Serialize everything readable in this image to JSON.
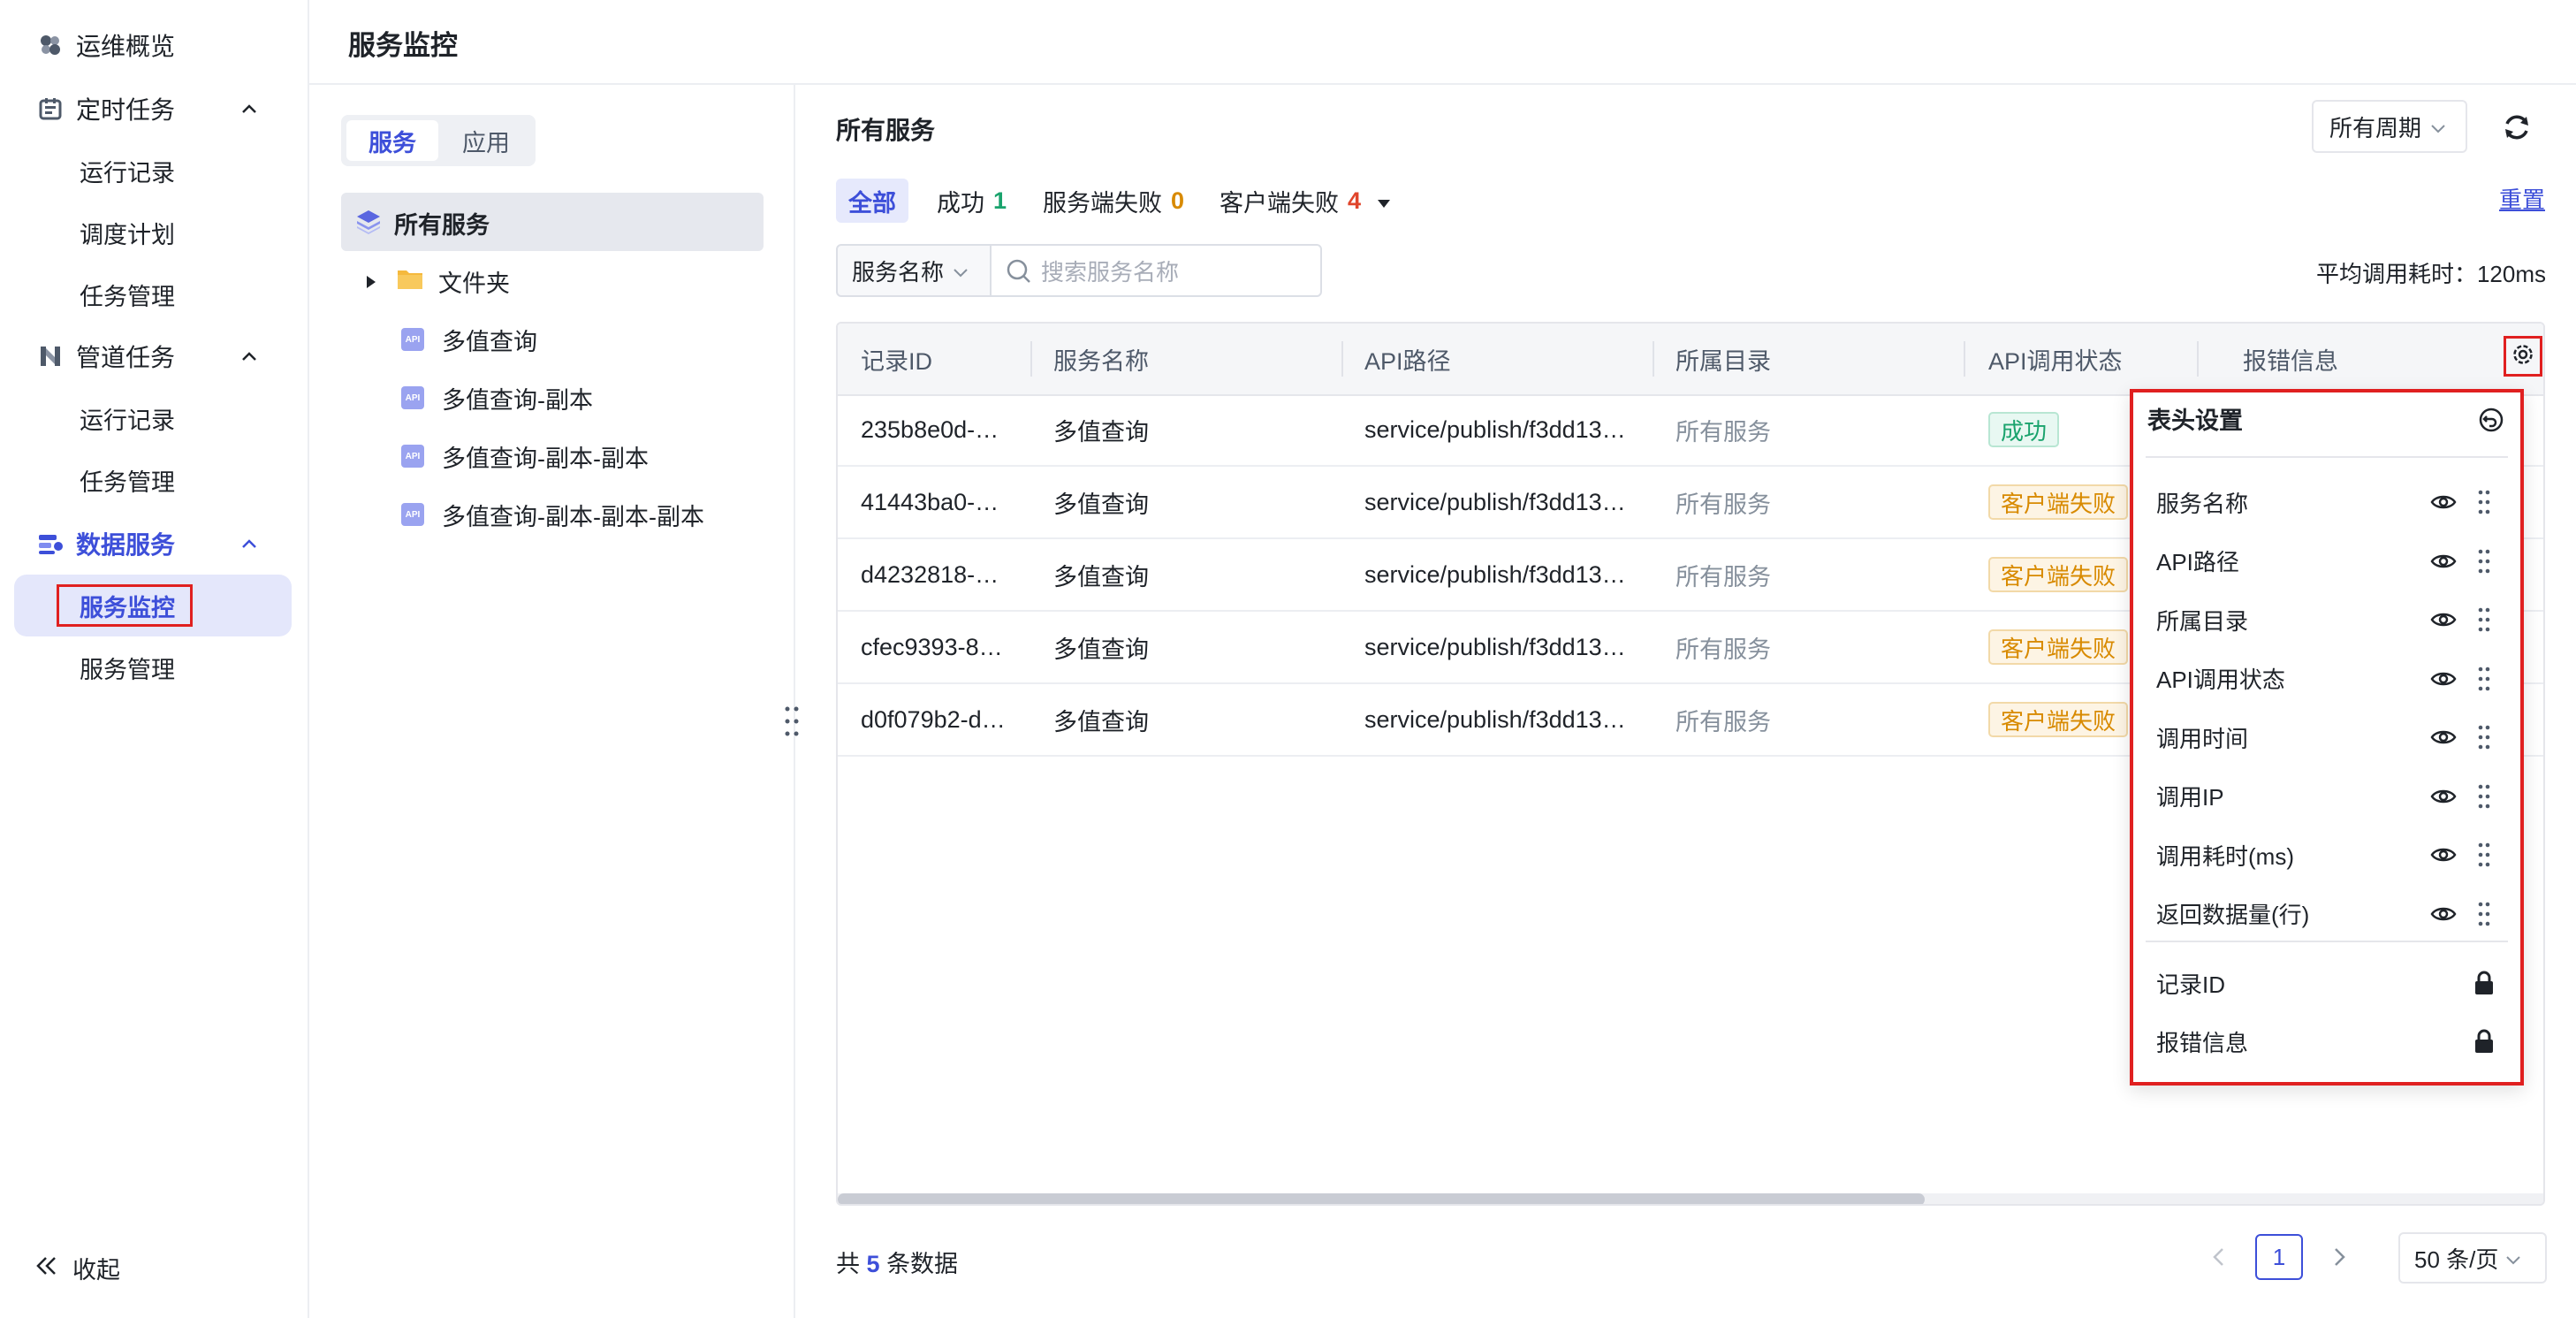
{
  "sidebar": {
    "overview": "运维概览",
    "scheduled": {
      "label": "定时任务",
      "items": [
        "运行记录",
        "调度计划",
        "任务管理"
      ]
    },
    "pipeline": {
      "label": "管道任务",
      "items": [
        "运行记录",
        "任务管理"
      ]
    },
    "data_service": {
      "label": "数据服务",
      "items": [
        "服务监控",
        "服务管理"
      ]
    },
    "collapse": "收起"
  },
  "header": {
    "title": "服务监控"
  },
  "tree": {
    "tabs": [
      "服务",
      "应用"
    ],
    "root": "所有服务",
    "folder": "文件夹",
    "api_badge": "API",
    "items": [
      "多值查询",
      "多值查询-副本",
      "多值查询-副本-副本",
      "多值查询-副本-副本-副本"
    ]
  },
  "main": {
    "title": "所有服务",
    "period": "所有周期",
    "filters": {
      "all": "全部",
      "success_label": "成功",
      "success_count": "1",
      "server_fail_label": "服务端失败",
      "server_fail_count": "0",
      "client_fail_label": "客户端失败",
      "client_fail_count": "4"
    },
    "reset": "重置",
    "search_field": "服务名称",
    "search_placeholder": "搜索服务名称",
    "avg_time": "平均调用耗时：120ms",
    "columns": [
      "记录ID",
      "服务名称",
      "API路径",
      "所属目录",
      "API调用状态",
      "报错信息"
    ],
    "rows": [
      {
        "id": "235b8e0d-…",
        "name": "多值查询",
        "path": "service/publish/f3dd13…",
        "dir": "所有服务",
        "status": "成功",
        "status_type": "success"
      },
      {
        "id": "41443ba0-…",
        "name": "多值查询",
        "path": "service/publish/f3dd13…",
        "dir": "所有服务",
        "status": "客户端失败",
        "status_type": "fail"
      },
      {
        "id": "d4232818-…",
        "name": "多值查询",
        "path": "service/publish/f3dd13…",
        "dir": "所有服务",
        "status": "客户端失败",
        "status_type": "fail"
      },
      {
        "id": "cfec9393-8…",
        "name": "多值查询",
        "path": "service/publish/f3dd13…",
        "dir": "所有服务",
        "status": "客户端失败",
        "status_type": "fail"
      },
      {
        "id": "d0f079b2-d…",
        "name": "多值查询",
        "path": "service/publish/f3dd13…",
        "dir": "所有服务",
        "status": "客户端失败",
        "status_type": "fail"
      }
    ],
    "footer": {
      "prefix": "共",
      "count": "5",
      "suffix": "条数据",
      "page": "1",
      "page_size": "50 条/页"
    }
  },
  "column_settings": {
    "title": "表头设置",
    "visible": [
      "服务名称",
      "API路径",
      "所属目录",
      "API调用状态",
      "调用时间",
      "调用IP",
      "调用耗时(ms)",
      "返回数据量(行)"
    ],
    "locked": [
      "记录ID",
      "报错信息"
    ]
  },
  "colors": {
    "accent": "#3d4fd9",
    "highlight_box": "#e02020",
    "success": "#1aa36d",
    "warning": "#d88a00",
    "danger": "#e0452b"
  }
}
